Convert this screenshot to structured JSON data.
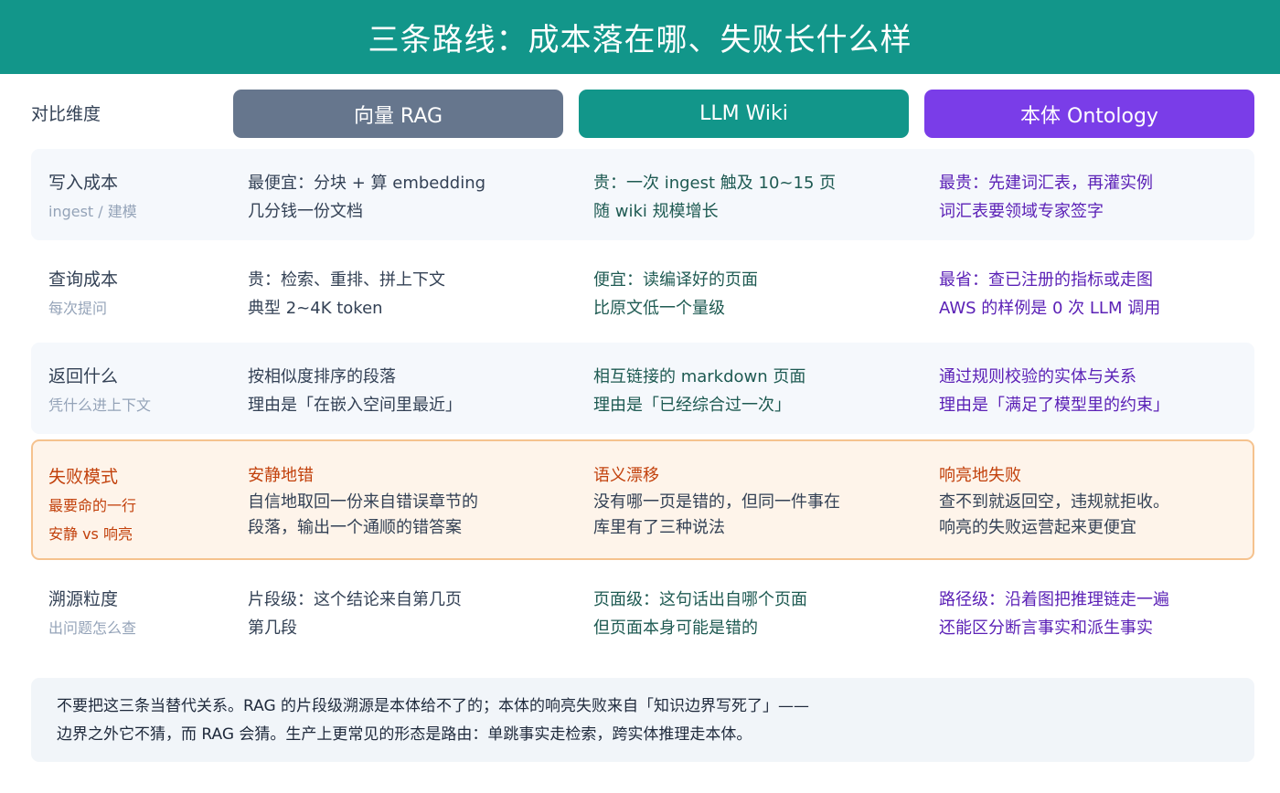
{
  "title": "三条路线：成本落在哪、失败长什么样",
  "header": {
    "dimension_label": "对比维度",
    "columns": [
      "向量 RAG",
      "LLM Wiki",
      "本体 Ontology"
    ]
  },
  "colors": {
    "banner": "#12968a",
    "rag": "#66768d",
    "wiki": "#12968a",
    "ontology": "#7a3de8",
    "failure_accent": "#c2410c"
  },
  "rows": [
    {
      "dimension": "写入成本",
      "sub": "ingest / 建模",
      "rag": [
        "最便宜：分块 + 算 embedding",
        "几分钱一份文档"
      ],
      "wiki": [
        "贵：一次 ingest 触及 10~15 页",
        "随 wiki 规模增长"
      ],
      "ontology": [
        "最贵：先建词汇表，再灌实例",
        "词汇表要领域专家签字"
      ]
    },
    {
      "dimension": "查询成本",
      "sub": "每次提问",
      "rag": [
        "贵：检索、重排、拼上下文",
        "典型 2~4K token"
      ],
      "wiki": [
        "便宜：读编译好的页面",
        "比原文低一个量级"
      ],
      "ontology": [
        "最省：查已注册的指标或走图",
        "AWS 的样例是 0 次 LLM 调用"
      ]
    },
    {
      "dimension": "返回什么",
      "sub": "凭什么进上下文",
      "rag": [
        "按相似度排序的段落",
        "理由是「在嵌入空间里最近」"
      ],
      "wiki": [
        "相互链接的 markdown 页面",
        "理由是「已经综合过一次」"
      ],
      "ontology": [
        "通过规则校验的实体与关系",
        "理由是「满足了模型里的约束」"
      ]
    },
    {
      "dimension": "失败模式",
      "sub1": "最要命的一行",
      "sub2": "安静 vs 响亮",
      "rag": {
        "title": "安静地错",
        "lines": [
          "自信地取回一份来自错误章节的",
          "段落，输出一个通顺的错答案"
        ]
      },
      "wiki": {
        "title": "语义漂移",
        "lines": [
          "没有哪一页是错的，但同一件事在",
          "库里有了三种说法"
        ]
      },
      "ontology": {
        "title": "响亮地失败",
        "lines": [
          "查不到就返回空，违规就拒收。",
          "响亮的失败运营起来更便宜"
        ]
      }
    },
    {
      "dimension": "溯源粒度",
      "sub": "出问题怎么查",
      "rag": [
        "片段级：这个结论来自第几页",
        "第几段"
      ],
      "wiki": [
        "页面级：这句话出自哪个页面",
        "但页面本身可能是错的"
      ],
      "ontology": [
        "路径级：沿着图把推理链走一遍",
        "还能区分断言事实和派生事实"
      ]
    }
  ],
  "footnote": [
    "不要把这三条当替代关系。RAG 的片段级溯源是本体给不了的；本体的响亮失败来自「知识边界写死了」——",
    "边界之外它不猜，而 RAG 会猜。生产上更常见的形态是路由：单跳事实走检索，跨实体推理走本体。"
  ]
}
